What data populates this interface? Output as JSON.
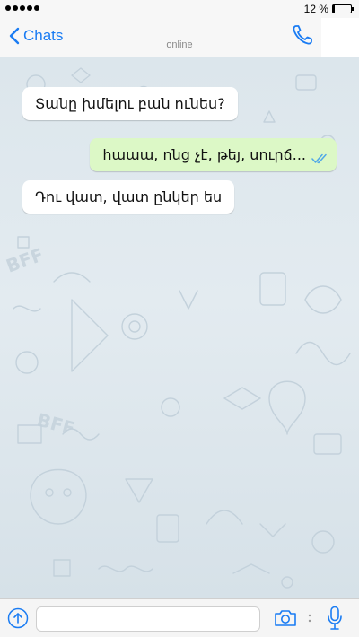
{
  "status_bar": {
    "battery_text": "12 %",
    "battery_level": 0.12
  },
  "header": {
    "back_label": "Chats",
    "presence": "online"
  },
  "messages": [
    {
      "direction": "incoming",
      "text": "Տանը խմելու բան ունես?"
    },
    {
      "direction": "outgoing",
      "text": "հաաա, ոնց չէ, թեյ, սուրճ...",
      "status": "read"
    },
    {
      "direction": "incoming",
      "text": "Դու վատ, վատ ընկեր ես"
    }
  ],
  "input": {
    "placeholder": ""
  },
  "colors": {
    "accent": "#1a7cf3",
    "outgoing_bubble": "#dcf8c6",
    "incoming_bubble": "#ffffff",
    "read_ticks": "#4fa7e8",
    "chat_background": "#dfe8ee"
  },
  "icons": {
    "back": "chevron-left-icon",
    "call": "phone-icon",
    "upload": "upload-icon",
    "camera": "camera-icon",
    "mic": "microphone-icon",
    "read_receipt": "double-check-icon"
  }
}
